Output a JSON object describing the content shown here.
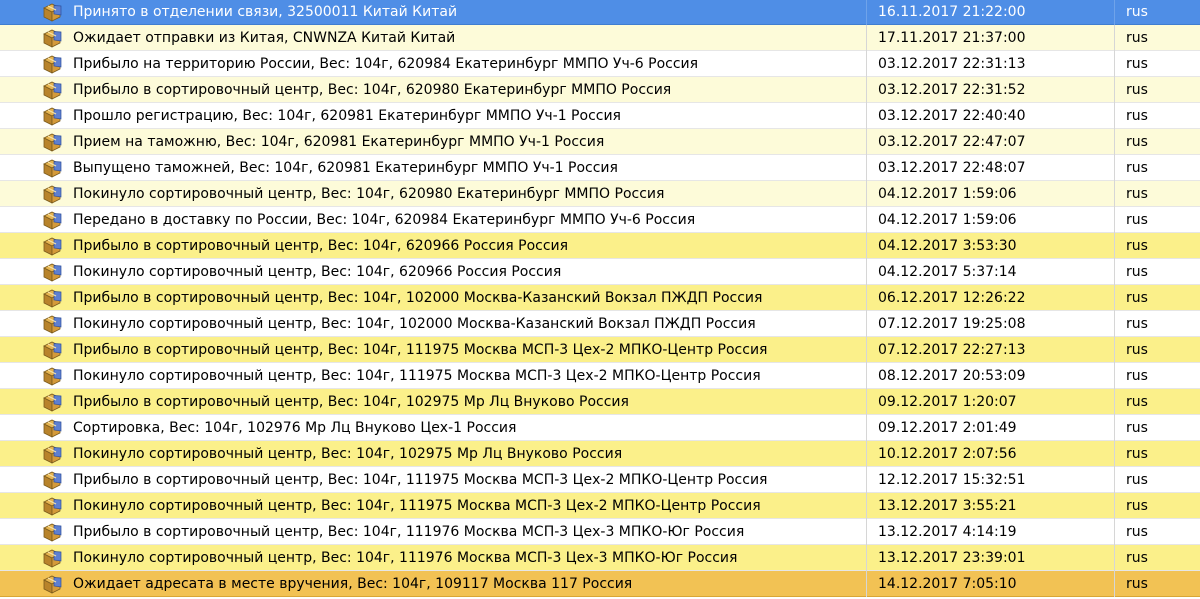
{
  "columns": {
    "status": "",
    "date": "",
    "lang": ""
  },
  "colors": {
    "row_white": "#ffffff",
    "row_cream": "#fdfbd9",
    "row_yellow": "#fbf08a",
    "row_selected": "#4f8ee6",
    "row_delivered": "#f2c254"
  },
  "rows": [
    {
      "status": "Принято в отделении связи, 32500011 Китай Китай",
      "date": "16.11.2017 21:22:00",
      "lang": "rus",
      "style": "selected",
      "icon": "package-icon"
    },
    {
      "status": "Ожидает отправки из Китая, CNWNZA Китай Китай",
      "date": "17.11.2017 21:37:00",
      "lang": "rus",
      "style": "cream",
      "icon": "package-icon"
    },
    {
      "status": "Прибыло на территорию России, Вес: 104г, 620984 Екатеринбург ММПО Уч-6 Россия",
      "date": "03.12.2017 22:31:13",
      "lang": "rus",
      "style": "white",
      "icon": "package-icon"
    },
    {
      "status": "Прибыло в сортировочный центр, Вес: 104г, 620980 Екатеринбург ММПО Россия",
      "date": "03.12.2017 22:31:52",
      "lang": "rus",
      "style": "cream",
      "icon": "package-icon"
    },
    {
      "status": "Прошло регистрацию, Вес: 104г, 620981 Екатеринбург ММПО Уч-1 Россия",
      "date": "03.12.2017 22:40:40",
      "lang": "rus",
      "style": "white",
      "icon": "package-icon"
    },
    {
      "status": "Прием на таможню, Вес: 104г, 620981 Екатеринбург ММПО Уч-1 Россия",
      "date": "03.12.2017 22:47:07",
      "lang": "rus",
      "style": "cream",
      "icon": "package-icon"
    },
    {
      "status": "Выпущено таможней, Вес: 104г, 620981 Екатеринбург ММПО Уч-1 Россия",
      "date": "03.12.2017 22:48:07",
      "lang": "rus",
      "style": "white",
      "icon": "package-icon"
    },
    {
      "status": "Покинуло сортировочный центр, Вес: 104г, 620980 Екатеринбург ММПО Россия",
      "date": "04.12.2017 1:59:06",
      "lang": "rus",
      "style": "cream",
      "icon": "package-icon"
    },
    {
      "status": "Передано в доставку по России, Вес: 104г, 620984 Екатеринбург ММПО Уч-6 Россия",
      "date": "04.12.2017 1:59:06",
      "lang": "rus",
      "style": "white",
      "icon": "package-icon"
    },
    {
      "status": "Прибыло в сортировочный центр, Вес: 104г, 620966 Россия Россия",
      "date": "04.12.2017 3:53:30",
      "lang": "rus",
      "style": "yellow",
      "icon": "package-icon"
    },
    {
      "status": "Покинуло сортировочный центр, Вес: 104г, 620966 Россия Россия",
      "date": "04.12.2017 5:37:14",
      "lang": "rus",
      "style": "white",
      "icon": "package-icon"
    },
    {
      "status": "Прибыло в сортировочный центр, Вес: 104г, 102000 Москва-Казанский Вокзал ПЖДП Россия",
      "date": "06.12.2017 12:26:22",
      "lang": "rus",
      "style": "yellow",
      "icon": "package-icon"
    },
    {
      "status": "Покинуло сортировочный центр, Вес: 104г, 102000 Москва-Казанский Вокзал ПЖДП Россия",
      "date": "07.12.2017 19:25:08",
      "lang": "rus",
      "style": "white",
      "icon": "package-icon"
    },
    {
      "status": "Прибыло в сортировочный центр, Вес: 104г, 111975 Москва МСП-3 Цех-2 МПКО-Центр Россия",
      "date": "07.12.2017 22:27:13",
      "lang": "rus",
      "style": "yellow",
      "icon": "package-icon"
    },
    {
      "status": "Покинуло сортировочный центр, Вес: 104г, 111975 Москва МСП-3 Цех-2 МПКО-Центр Россия",
      "date": "08.12.2017 20:53:09",
      "lang": "rus",
      "style": "white",
      "icon": "package-icon"
    },
    {
      "status": "Прибыло в сортировочный центр, Вес: 104г, 102975 Мр Лц Внуково Россия",
      "date": "09.12.2017 1:20:07",
      "lang": "rus",
      "style": "yellow",
      "icon": "package-icon"
    },
    {
      "status": "Сортировка, Вес: 104г, 102976 Мр Лц Внуково Цех-1 Россия",
      "date": "09.12.2017 2:01:49",
      "lang": "rus",
      "style": "white",
      "icon": "package-icon"
    },
    {
      "status": "Покинуло сортировочный центр, Вес: 104г, 102975 Мр Лц Внуково Россия",
      "date": "10.12.2017 2:07:56",
      "lang": "rus",
      "style": "yellow",
      "icon": "package-icon"
    },
    {
      "status": "Прибыло в сортировочный центр, Вес: 104г, 111975 Москва МСП-3 Цех-2 МПКО-Центр Россия",
      "date": "12.12.2017 15:32:51",
      "lang": "rus",
      "style": "white",
      "icon": "package-icon"
    },
    {
      "status": "Покинуло сортировочный центр, Вес: 104г, 111975 Москва МСП-3 Цех-2 МПКО-Центр Россия",
      "date": "13.12.2017 3:55:21",
      "lang": "rus",
      "style": "yellow",
      "icon": "package-icon"
    },
    {
      "status": "Прибыло в сортировочный центр, Вес: 104г, 111976 Москва МСП-3 Цех-3 МПКО-Юг Россия",
      "date": "13.12.2017 4:14:19",
      "lang": "rus",
      "style": "white",
      "icon": "package-icon"
    },
    {
      "status": "Покинуло сортировочный центр, Вес: 104г, 111976 Москва МСП-3 Цех-3 МПКО-Юг Россия",
      "date": "13.12.2017 23:39:01",
      "lang": "rus",
      "style": "yellow",
      "icon": "package-icon"
    },
    {
      "status": "Ожидает адресата в месте вручения, Вес: 104г, 109117 Москва 117 Россия",
      "date": "14.12.2017 7:05:10",
      "lang": "rus",
      "style": "orange",
      "icon": "package-icon"
    }
  ]
}
